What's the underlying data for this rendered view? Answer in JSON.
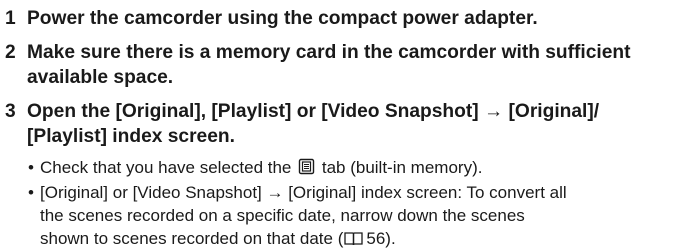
{
  "steps": [
    {
      "number": "1",
      "text": "Power the camcorder using the compact power adapter."
    },
    {
      "number": "2",
      "line1": "Make sure there is a memory card in the camcorder with sufficient",
      "line2": "available space."
    },
    {
      "number": "3",
      "line1": "Open the [Original], [Playlist] or [Video Snapshot] → [Original]/",
      "line2": "[Playlist] index screen.",
      "bullets": [
        {
          "pre": "Check that you have selected the",
          "icon": "built-in-memory-icon",
          "post": "tab (built-in memory)."
        },
        {
          "line1": "[Original] or [Video Snapshot] → [Original] index screen: To convert all",
          "line2": "the scenes recorded on a specific date, narrow down the scenes",
          "line3_pre": "shown to scenes recorded on that date (",
          "icon": "book-reference-icon",
          "page_ref": "56",
          "line3_post": ")."
        }
      ]
    }
  ]
}
